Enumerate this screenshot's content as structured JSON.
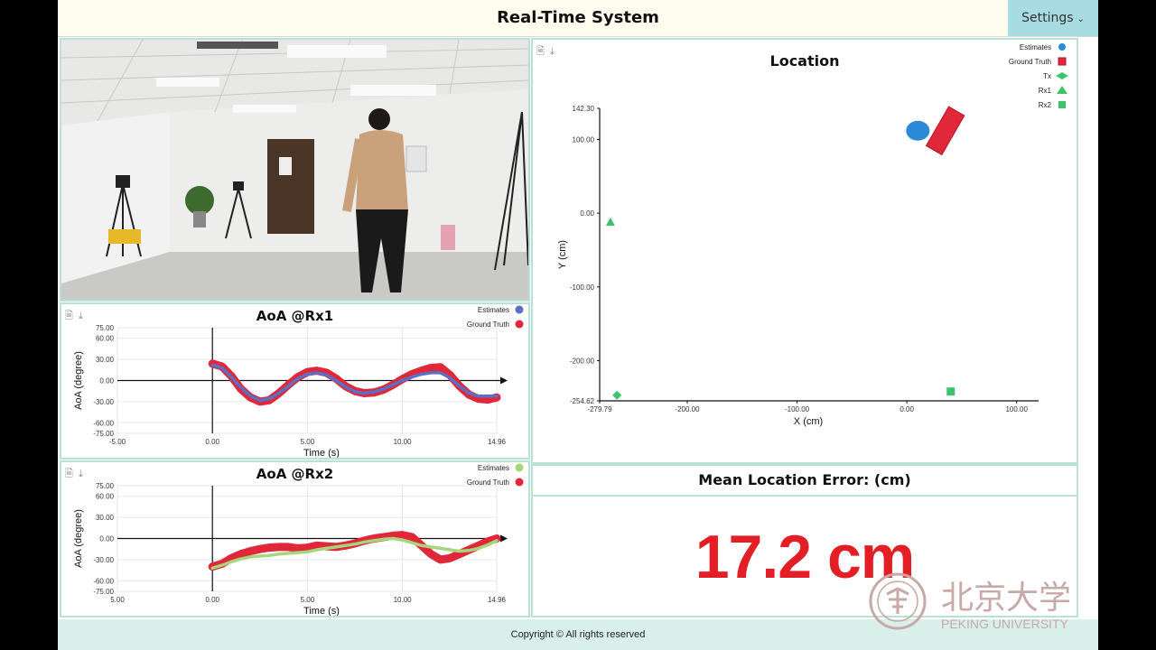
{
  "header": {
    "title": "Real-Time System",
    "settings_label": "Settings"
  },
  "footer": {
    "copyright": "Copyright © All rights reserved"
  },
  "aoa_rx1": {
    "title": "AoA @Rx1",
    "legend": [
      "Estimates",
      "Ground Truth"
    ],
    "ylabel": "AoA (degree)",
    "xlabel": "Time (s)",
    "yticks": [
      "75.00",
      "60.00",
      "30.00",
      "0.00",
      "-30.00",
      "-60.00",
      "-75.00"
    ],
    "xticks": [
      "-5.00",
      "0.00",
      "5.00",
      "10.00",
      "14.96"
    ]
  },
  "aoa_rx2": {
    "title": "AoA @Rx2",
    "legend": [
      "Estimates",
      "Ground Truth"
    ],
    "ylabel": "AoA (degree)",
    "xlabel": "Time (s)",
    "yticks": [
      "75.00",
      "60.00",
      "30.00",
      "0.00",
      "-30.00",
      "-60.00",
      "-75.00"
    ],
    "xticks": [
      "5.00",
      "0.00",
      "5.00",
      "10.00",
      "14.96"
    ]
  },
  "location": {
    "title": "Location",
    "legend": [
      "Estimates",
      "Ground Truth",
      "Tx",
      "Rx1",
      "Rx2"
    ],
    "ylabel": "Y (cm)",
    "xlabel": "X (cm)",
    "yticks": [
      "142.30",
      "100.00",
      "0.00",
      "-100.00",
      "-200.00",
      "-254.62"
    ],
    "xticks": [
      "-279.79",
      "-200.00",
      "-100.00",
      "0.00",
      "100.00"
    ]
  },
  "error": {
    "heading": "Mean Location Error: (cm)",
    "value": "17.2 cm"
  },
  "logo": {
    "chinese": "北京大学",
    "english": "PEKING UNIVERSITY",
    "seal_text": "PEKING UNIVERSITY 1898"
  },
  "colors": {
    "estimates_rx1": "#5b6fc4",
    "estimates_rx2": "#a6d67a",
    "ground_truth": "#e0283a",
    "estimate_loc": "#2a8ad8",
    "markers": "#3cc36b",
    "error_text": "#e31e24"
  },
  "chart_data": [
    {
      "type": "line",
      "title": "AoA @Rx1",
      "xlabel": "Time (s)",
      "ylabel": "AoA (degree)",
      "xlim": [
        -5,
        14.96
      ],
      "ylim": [
        -75,
        75
      ],
      "series": [
        {
          "name": "Estimates",
          "x": [
            0,
            0.5,
            1,
            1.5,
            2,
            2.5,
            3,
            3.5,
            4,
            4.5,
            5,
            5.5,
            6,
            6.5,
            7,
            7.5,
            8,
            8.5,
            9,
            9.5,
            10,
            10.5,
            11,
            11.5,
            12,
            12.5,
            13,
            13.5,
            14,
            14.5,
            14.96
          ],
          "y": [
            22,
            18,
            5,
            -10,
            -22,
            -28,
            -26,
            -18,
            -8,
            3,
            9,
            11,
            8,
            0,
            -9,
            -16,
            -18,
            -16,
            -12,
            -6,
            0,
            5,
            9,
            11,
            11,
            4,
            -8,
            -18,
            -22,
            -22,
            -22
          ]
        },
        {
          "name": "Ground Truth",
          "x": [
            0,
            0.5,
            1,
            1.5,
            2,
            2.5,
            3,
            3.5,
            4,
            4.5,
            5,
            5.5,
            6,
            6.5,
            7,
            7.5,
            8,
            8.5,
            9,
            9.5,
            10,
            10.5,
            11,
            11.5,
            12,
            12.5,
            13,
            13.5,
            14,
            14.5,
            14.96
          ],
          "y": [
            24,
            20,
            6,
            -12,
            -24,
            -30,
            -28,
            -18,
            -6,
            5,
            12,
            14,
            11,
            3,
            -8,
            -15,
            -18,
            -17,
            -13,
            -6,
            2,
            9,
            14,
            18,
            19,
            8,
            -8,
            -20,
            -26,
            -27,
            -24
          ]
        }
      ]
    },
    {
      "type": "line",
      "title": "AoA @Rx2",
      "xlabel": "Time (s)",
      "ylabel": "AoA (degree)",
      "xlim": [
        -5,
        14.96
      ],
      "ylim": [
        -75,
        75
      ],
      "series": [
        {
          "name": "Estimates",
          "x": [
            0,
            0.5,
            1,
            1.5,
            2,
            2.5,
            3,
            3.5,
            4,
            4.5,
            5,
            5.5,
            6,
            6.5,
            7,
            7.5,
            8,
            8.5,
            9,
            9.5,
            10,
            10.5,
            11,
            11.5,
            12,
            12.5,
            13,
            13.5,
            14,
            14.5,
            14.96
          ],
          "y": [
            -42,
            -38,
            -33,
            -29,
            -26,
            -25,
            -24,
            -22,
            -21,
            -20,
            -19,
            -16,
            -14,
            -12,
            -10,
            -8,
            -5,
            -3,
            -1,
            0,
            -2,
            -6,
            -10,
            -12,
            -14,
            -16,
            -18,
            -17,
            -14,
            -9,
            -3
          ]
        },
        {
          "name": "Ground Truth",
          "x": [
            0,
            0.5,
            1,
            1.5,
            2,
            2.5,
            3,
            3.5,
            4,
            4.5,
            5,
            5.5,
            6,
            6.5,
            7,
            7.5,
            8,
            8.5,
            9,
            9.5,
            10,
            10.5,
            11,
            11.5,
            12,
            12.5,
            13,
            13.5,
            14,
            14.5,
            14.96
          ],
          "y": [
            -40,
            -36,
            -28,
            -22,
            -18,
            -15,
            -13,
            -12,
            -12,
            -14,
            -13,
            -10,
            -11,
            -12,
            -10,
            -7,
            -3,
            0,
            2,
            4,
            5,
            2,
            -10,
            -22,
            -30,
            -28,
            -22,
            -16,
            -10,
            -4,
            0
          ]
        }
      ]
    },
    {
      "type": "scatter",
      "title": "Location",
      "xlabel": "X (cm)",
      "ylabel": "Y (cm)",
      "xlim": [
        -279.79,
        120
      ],
      "ylim": [
        -254.62,
        142.3
      ],
      "series": [
        {
          "name": "Estimates",
          "x": [
            10
          ],
          "y": [
            112
          ]
        },
        {
          "name": "Ground Truth",
          "x": [
            35
          ],
          "y": [
            112
          ]
        },
        {
          "name": "Rx1",
          "x": [
            -270
          ],
          "y": [
            -12
          ]
        },
        {
          "name": "Tx",
          "x": [
            -264
          ],
          "y": [
            -247
          ]
        },
        {
          "name": "Rx2",
          "x": [
            40
          ],
          "y": [
            -242
          ]
        }
      ]
    }
  ]
}
